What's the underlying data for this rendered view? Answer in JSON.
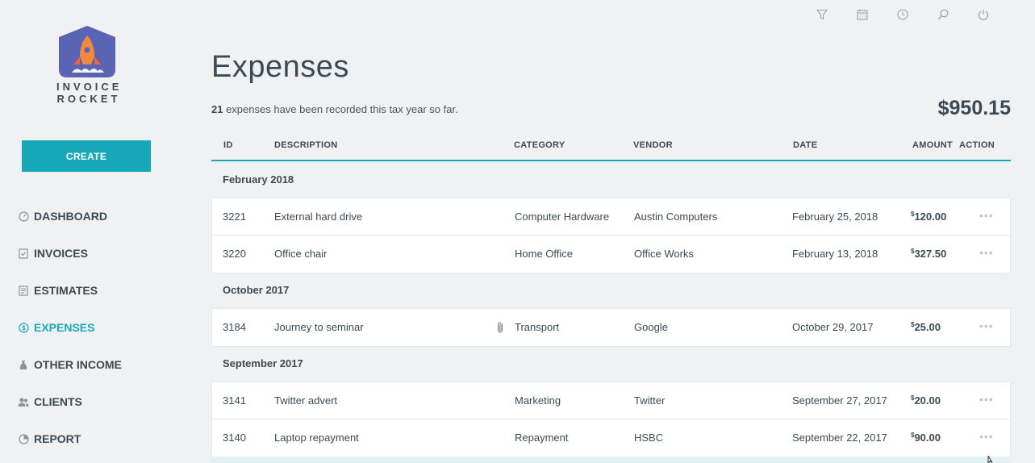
{
  "brand": {
    "name": "INVOICE\nROCKET"
  },
  "sidebar": {
    "create_label": "CREATE",
    "items": [
      {
        "label": "DASHBOARD",
        "icon": "dashboard-icon"
      },
      {
        "label": "INVOICES",
        "icon": "invoice-icon"
      },
      {
        "label": "ESTIMATES",
        "icon": "estimate-icon"
      },
      {
        "label": "EXPENSES",
        "icon": "dollar-circle-icon",
        "active": true
      },
      {
        "label": "OTHER INCOME",
        "icon": "money-bag-icon"
      },
      {
        "label": "CLIENTS",
        "icon": "people-icon"
      },
      {
        "label": "REPORT",
        "icon": "pie-chart-icon"
      }
    ]
  },
  "topbar": {
    "icons": [
      "filter-icon",
      "calendar-icon",
      "clock-icon",
      "search-icon",
      "power-icon"
    ]
  },
  "page": {
    "title": "Expenses",
    "count": "21",
    "summary_text": " expenses have been recorded this tax year so far.",
    "total": "$950.15"
  },
  "table": {
    "headers": {
      "id": "ID",
      "description": "DESCRIPTION",
      "category": "CATEGORY",
      "vendor": "VENDOR",
      "date": "DATE",
      "amount": "AMOUNT",
      "action": "ACTION"
    },
    "groups": [
      {
        "label": "February 2018",
        "rows": [
          {
            "id": "3221",
            "description": "External hard drive",
            "category": "Computer Hardware",
            "vendor": "Austin Computers",
            "date": "February 25, 2018",
            "currency": "$",
            "amount": "120.00"
          },
          {
            "id": "3220",
            "description": "Office chair",
            "category": "Home Office",
            "vendor": "Office Works",
            "date": "February 13, 2018",
            "currency": "$",
            "amount": "327.50"
          }
        ]
      },
      {
        "label": "October 2017",
        "rows": [
          {
            "id": "3184",
            "description": "Journey to seminar",
            "category": "Transport",
            "vendor": "Google",
            "date": "October 29, 2017",
            "currency": "$",
            "amount": "25.00",
            "attachment": true
          }
        ]
      },
      {
        "label": "September 2017",
        "rows": [
          {
            "id": "3141",
            "description": "Twitter advert",
            "category": "Marketing",
            "vendor": "Twitter",
            "date": "September 27, 2017",
            "currency": "$",
            "amount": "20.00"
          },
          {
            "id": "3140",
            "description": "Laptop repayment",
            "category": "Repayment",
            "vendor": "HSBC",
            "date": "September 22, 2017",
            "currency": "$",
            "amount": "90.00"
          }
        ]
      }
    ],
    "action_glyph": "•••"
  },
  "colors": {
    "accent": "#17a9b7",
    "text": "#3c4a54",
    "logo": "#5b64b4",
    "logo_flame": "#f08a3c"
  }
}
